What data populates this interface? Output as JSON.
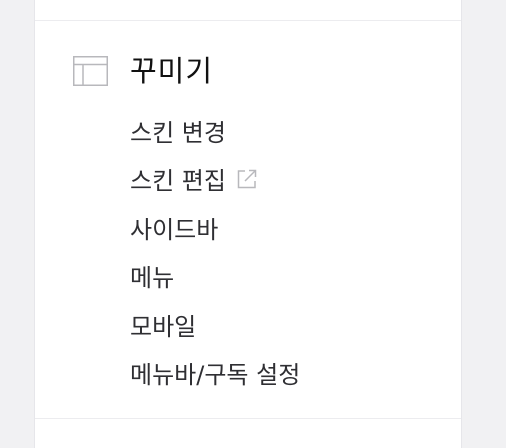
{
  "section": {
    "icon": "layout-icon",
    "title": "꾸미기",
    "items": [
      {
        "label": "스킨 변경",
        "external": false
      },
      {
        "label": "스킨 편집",
        "external": true,
        "icon": "external-link-icon"
      },
      {
        "label": "사이드바",
        "external": false
      },
      {
        "label": "메뉴",
        "external": false
      },
      {
        "label": "모바일",
        "external": false
      },
      {
        "label": "메뉴바/구독 설정",
        "external": false
      }
    ]
  },
  "colors": {
    "background": "#f1f1f3",
    "panel": "#ffffff",
    "title_text": "#111111",
    "item_text": "#2f2f33",
    "icon_stroke": "#b8b8bc"
  }
}
